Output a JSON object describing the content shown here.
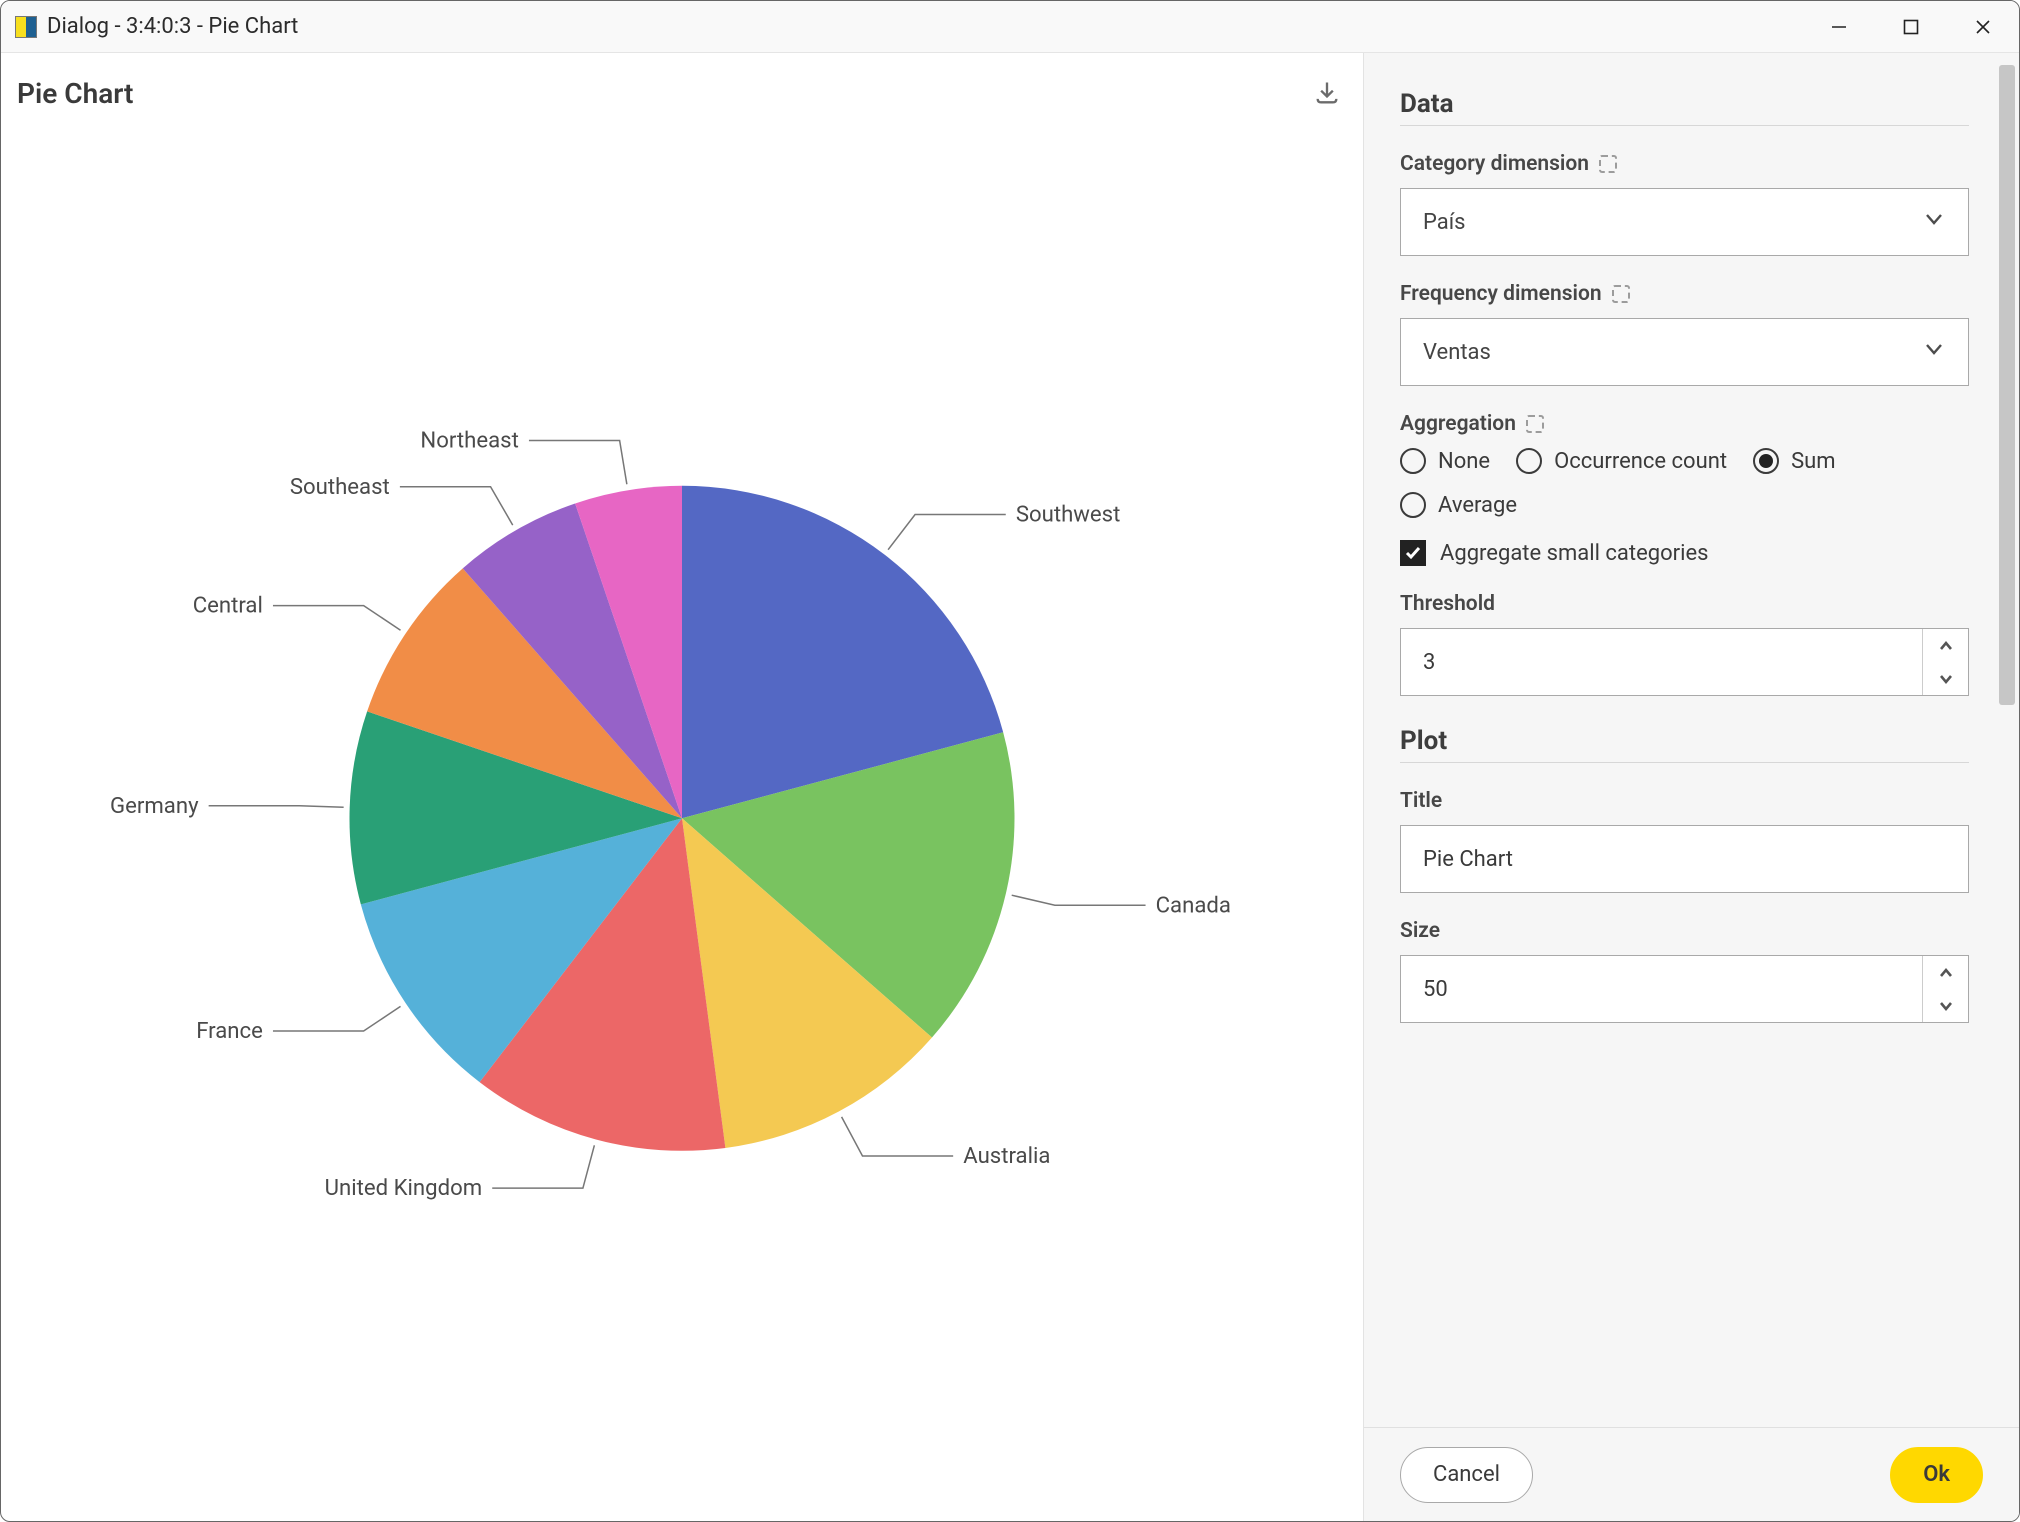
{
  "window": {
    "title": "Dialog - 3:4:0:3 - Pie Chart"
  },
  "chart": {
    "title": "Pie Chart"
  },
  "chart_data": {
    "type": "pie",
    "title": "Pie Chart",
    "slices": [
      {
        "label": "Southwest",
        "value": 20,
        "color": "#5468c4"
      },
      {
        "label": "Canada",
        "value": 15,
        "color": "#79c360"
      },
      {
        "label": "Australia",
        "value": 11,
        "color": "#f4c952"
      },
      {
        "label": "United Kingdom",
        "value": 12,
        "color": "#ec6767"
      },
      {
        "label": "France",
        "value": 10,
        "color": "#55b1d9"
      },
      {
        "label": "Germany",
        "value": 9,
        "color": "#29a076"
      },
      {
        "label": "Central",
        "value": 8,
        "color": "#f18d47"
      },
      {
        "label": "Southeast",
        "value": 6,
        "color": "#9662c8"
      },
      {
        "label": "Northeast",
        "value": 5,
        "color": "#e766c4"
      }
    ]
  },
  "panel": {
    "data_h": "Data",
    "category_dim_label": "Category dimension",
    "category_dim_value": "País",
    "freq_dim_label": "Frequency dimension",
    "freq_dim_value": "Ventas",
    "aggregation_label": "Aggregation",
    "aggregation_options": {
      "none": "None",
      "occurrence": "Occurrence count",
      "sum": "Sum",
      "average": "Average"
    },
    "aggregation_selected": "sum",
    "aggregate_small_label": "Aggregate small categories",
    "threshold_label": "Threshold",
    "threshold_value": "3",
    "plot_h": "Plot",
    "title_label": "Title",
    "title_value": "Pie Chart",
    "size_label": "Size",
    "size_value": "50"
  },
  "footer": {
    "cancel": "Cancel",
    "ok": "Ok"
  }
}
